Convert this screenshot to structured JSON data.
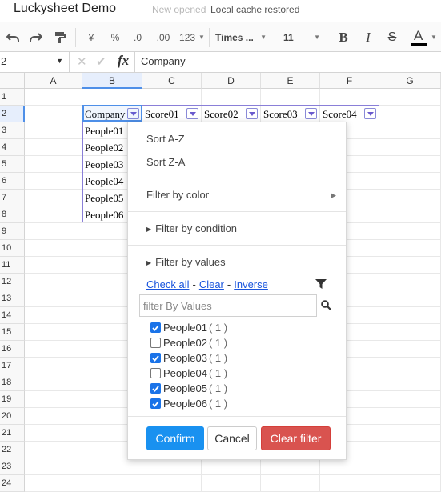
{
  "app": {
    "title": "Luckysheet Demo",
    "status_new": "New opened",
    "status_cache": "Local cache restored"
  },
  "toolbar": {
    "undo_icon": "undo-icon",
    "redo_icon": "redo-icon",
    "paint_format_icon": "paint-format-icon",
    "currency_label": "¥",
    "percent_label": "%",
    "decrease_decimal_label": ".0",
    "increase_decimal_label": ".00",
    "number_format_label": "123",
    "font_family": "Times ...",
    "font_size": "11",
    "bold_label": "B",
    "italic_label": "I",
    "strike_label": "S",
    "text_color_label": "A",
    "text_color": "#000000"
  },
  "formula_bar": {
    "name_box": "2",
    "cancel_glyph": "✕",
    "confirm_glyph": "✔",
    "fx_label": "fx",
    "value": "Company"
  },
  "sheet": {
    "columns": [
      "A",
      "B",
      "C",
      "D",
      "E",
      "F",
      "G"
    ],
    "rows": [
      "1",
      "2",
      "3",
      "4",
      "5",
      "6",
      "7",
      "8",
      "9",
      "10",
      "11",
      "12",
      "13",
      "14",
      "15",
      "16",
      "17",
      "18",
      "19",
      "20",
      "21",
      "22",
      "23",
      "24"
    ],
    "header_cells": [
      "Company",
      "Score01",
      "Score02",
      "Score03",
      "Score04"
    ],
    "column_b_values": [
      "People01",
      "People02",
      "People03",
      "People04",
      "People05",
      "People06"
    ],
    "selected_column": "B",
    "selected_row": "2",
    "accent_color": "#4e8fe8",
    "filter_border_color": "#8a7fd8"
  },
  "filter_menu": {
    "sort_az": "Sort A-Z",
    "sort_za": "Sort Z-A",
    "filter_by_color": "Filter by color",
    "filter_by_condition": "Filter by condition",
    "filter_by_values": "Filter by values",
    "check_all": "Check all",
    "clear": "Clear",
    "inverse": "Inverse",
    "dash": "-",
    "search_placeholder": "filter By Values",
    "values": [
      {
        "label": "People01",
        "count": "( 1 )",
        "checked": true
      },
      {
        "label": "People02",
        "count": "( 1 )",
        "checked": false
      },
      {
        "label": "People03",
        "count": "( 1 )",
        "checked": true
      },
      {
        "label": "People04",
        "count": "( 1 )",
        "checked": false
      },
      {
        "label": "People05",
        "count": "( 1 )",
        "checked": true
      },
      {
        "label": "People06",
        "count": "( 1 )",
        "checked": true
      }
    ],
    "confirm_label": "Confirm",
    "cancel_label": "Cancel",
    "clear_filter_label": "Clear filter",
    "confirm_color": "#1991f0",
    "clear_filter_color": "#d9534f",
    "check_color": "#1a73e8"
  }
}
